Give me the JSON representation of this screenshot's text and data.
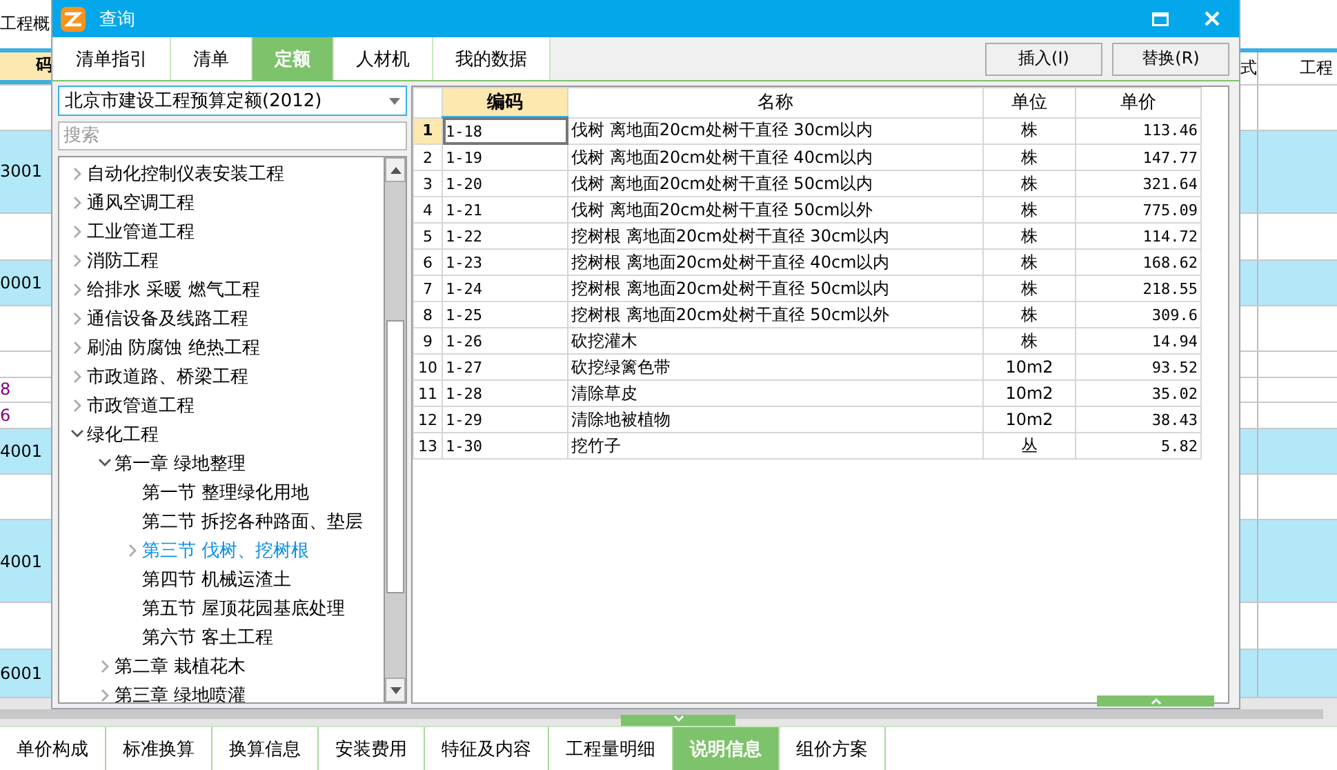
{
  "background": {
    "title_fragment": "工程概",
    "left_header": "码",
    "right_headers": [
      "式",
      "工程"
    ],
    "rows": [
      {
        "highlighted": false
      },
      {
        "code": "3001",
        "highlighted": true,
        "color": "#000000"
      },
      {
        "highlighted": false
      },
      {
        "code": "0001",
        "highlighted": true,
        "color": "#000000"
      },
      {
        "highlighted": false
      },
      {
        "highlighted": false
      },
      {
        "code": "8",
        "highlighted": false,
        "color": "#800080"
      },
      {
        "code": "6",
        "highlighted": false,
        "color": "#800080"
      },
      {
        "code": "4001",
        "highlighted": true,
        "color": "#000000"
      },
      {
        "highlighted": false
      },
      {
        "code": "4001",
        "highlighted": true,
        "color": "#000000"
      },
      {
        "highlighted": false
      },
      {
        "code": "6001",
        "highlighted": true,
        "color": "#000000"
      }
    ],
    "bottom_tabs": [
      {
        "label": "单价构成",
        "selected": false
      },
      {
        "label": "标准换算",
        "selected": false
      },
      {
        "label": "换算信息",
        "selected": false
      },
      {
        "label": "安装费用",
        "selected": false
      },
      {
        "label": "特征及内容",
        "selected": false
      },
      {
        "label": "工程量明细",
        "selected": false
      },
      {
        "label": "说明信息",
        "selected": true
      },
      {
        "label": "组价方案",
        "selected": false
      }
    ]
  },
  "dialog": {
    "title": "查询",
    "tabs": [
      {
        "label": "清单指引",
        "selected": false
      },
      {
        "label": "清单",
        "selected": false
      },
      {
        "label": "定额",
        "selected": true
      },
      {
        "label": "人材机",
        "selected": false
      },
      {
        "label": "我的数据",
        "selected": false
      }
    ],
    "buttons": [
      "插入(I)",
      "替换(R)"
    ],
    "library_select": {
      "value": "北京市建设工程预算定额(2012)"
    },
    "search": {
      "placeholder": "搜索"
    },
    "tree": [
      {
        "label": "自动化控制仪表安装工程",
        "kind": "folder",
        "expanded": false,
        "selected": false
      },
      {
        "label": "通风空调工程",
        "kind": "folder",
        "expanded": false,
        "selected": false
      },
      {
        "label": "工业管道工程",
        "kind": "folder",
        "expanded": false,
        "selected": false
      },
      {
        "label": "消防工程",
        "kind": "folder",
        "expanded": false,
        "selected": false
      },
      {
        "label": "给排水 采暖 燃气工程",
        "kind": "folder",
        "expanded": false,
        "selected": false
      },
      {
        "label": "通信设备及线路工程",
        "kind": "folder",
        "expanded": false,
        "selected": false
      },
      {
        "label": "刷油 防腐蚀 绝热工程",
        "kind": "folder",
        "expanded": false,
        "selected": false
      },
      {
        "label": "市政道路、桥梁工程",
        "kind": "folder",
        "expanded": false,
        "selected": false
      },
      {
        "label": "市政管道工程",
        "kind": "folder",
        "expanded": false,
        "selected": false
      },
      {
        "label": "绿化工程",
        "kind": "folder",
        "expanded": true,
        "selected": false,
        "children": [
          {
            "label": "第一章 绿地整理",
            "kind": "folder",
            "expanded": true,
            "selected": false,
            "children": [
              {
                "label": "第一节 整理绿化用地",
                "kind": "leaf",
                "selected": false
              },
              {
                "label": "第二节 拆挖各种路面、垫层",
                "kind": "leaf",
                "selected": false
              },
              {
                "label": "第三节 伐树、挖树根",
                "kind": "folder",
                "expanded": false,
                "selected": true
              },
              {
                "label": "第四节 机械运渣土",
                "kind": "leaf",
                "selected": false
              },
              {
                "label": "第五节 屋顶花园基底处理",
                "kind": "leaf",
                "selected": false
              },
              {
                "label": "第六节 客土工程",
                "kind": "leaf",
                "selected": false
              }
            ]
          },
          {
            "label": "第二章 栽植花木",
            "kind": "folder",
            "expanded": false,
            "selected": false
          },
          {
            "label": "第三章 绿地喷灌",
            "kind": "folder",
            "expanded": false,
            "selected": false
          }
        ]
      }
    ],
    "table": {
      "columns": [
        "编码",
        "名称",
        "单位",
        "单价"
      ],
      "rows": [
        {
          "number": "1",
          "code": "1-18",
          "name": "伐树 离地面20cm处树干直径 30cm以内",
          "unit": "株",
          "price": "113.46",
          "selected": true
        },
        {
          "number": "2",
          "code": "1-19",
          "name": "伐树 离地面20cm处树干直径 40cm以内",
          "unit": "株",
          "price": "147.77",
          "selected": false
        },
        {
          "number": "3",
          "code": "1-20",
          "name": "伐树 离地面20cm处树干直径 50cm以内",
          "unit": "株",
          "price": "321.64",
          "selected": false
        },
        {
          "number": "4",
          "code": "1-21",
          "name": "伐树 离地面20cm处树干直径 50cm以外",
          "unit": "株",
          "price": "775.09",
          "selected": false
        },
        {
          "number": "5",
          "code": "1-22",
          "name": "挖树根 离地面20cm处树干直径 30cm以内",
          "unit": "株",
          "price": "114.72",
          "selected": false
        },
        {
          "number": "6",
          "code": "1-23",
          "name": "挖树根 离地面20cm处树干直径 40cm以内",
          "unit": "株",
          "price": "168.62",
          "selected": false
        },
        {
          "number": "7",
          "code": "1-24",
          "name": "挖树根 离地面20cm处树干直径 50cm以内",
          "unit": "株",
          "price": "218.55",
          "selected": false
        },
        {
          "number": "8",
          "code": "1-25",
          "name": "挖树根 离地面20cm处树干直径 50cm以外",
          "unit": "株",
          "price": "309.6",
          "selected": false
        },
        {
          "number": "9",
          "code": "1-26",
          "name": "砍挖灌木",
          "unit": "株",
          "price": "14.94",
          "selected": false
        },
        {
          "number": "10",
          "code": "1-27",
          "name": "砍挖绿篱色带",
          "unit": "10m2",
          "price": "93.52",
          "selected": false
        },
        {
          "number": "11",
          "code": "1-28",
          "name": "清除草皮",
          "unit": "10m2",
          "price": "35.02",
          "selected": false
        },
        {
          "number": "12",
          "code": "1-29",
          "name": "清除地被植物",
          "unit": "10m2",
          "price": "38.43",
          "selected": false
        },
        {
          "number": "13",
          "code": "1-30",
          "name": "挖竹子",
          "unit": "丛",
          "price": "5.82",
          "selected": false
        }
      ]
    }
  }
}
